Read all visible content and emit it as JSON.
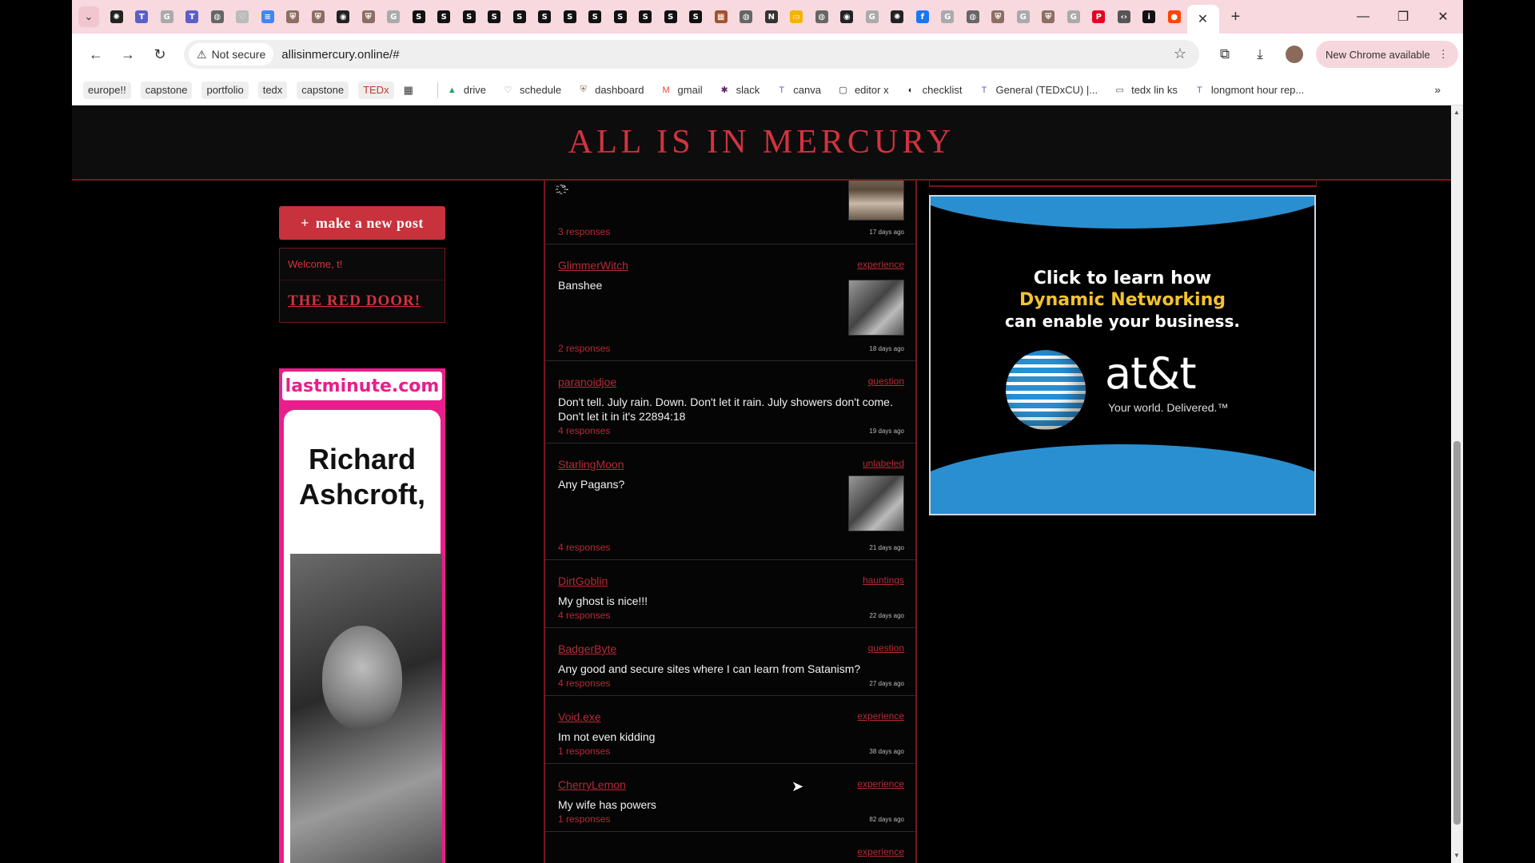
{
  "browser": {
    "tab_icons": [
      {
        "name": "openai-icon",
        "color": "#222"
      },
      {
        "name": "teams-icon",
        "color": "#5b5fc7"
      },
      {
        "name": "google-icon",
        "color": "#aaa"
      },
      {
        "name": "teams-icon",
        "color": "#5b5fc7"
      },
      {
        "name": "globe-icon",
        "color": "#666"
      },
      {
        "name": "heart-icon",
        "color": "#bbb"
      },
      {
        "name": "docs-icon",
        "color": "#4285f4"
      },
      {
        "name": "canvas-icon",
        "color": "#8d6e63"
      },
      {
        "name": "canvas-icon",
        "color": "#8d6e63"
      },
      {
        "name": "github-icon",
        "color": "#222"
      },
      {
        "name": "canvas-icon",
        "color": "#8d6e63"
      },
      {
        "name": "google-icon",
        "color": "#aaa"
      },
      {
        "name": "s-icon",
        "color": "#111"
      },
      {
        "name": "s-icon",
        "color": "#111"
      },
      {
        "name": "s-icon",
        "color": "#111"
      },
      {
        "name": "s-icon",
        "color": "#111"
      },
      {
        "name": "s-icon",
        "color": "#111"
      },
      {
        "name": "s-icon",
        "color": "#111"
      },
      {
        "name": "s-icon",
        "color": "#111"
      },
      {
        "name": "s-icon",
        "color": "#111"
      },
      {
        "name": "s-icon",
        "color": "#111"
      },
      {
        "name": "s-icon",
        "color": "#111"
      },
      {
        "name": "s-icon",
        "color": "#111"
      },
      {
        "name": "s-icon",
        "color": "#111"
      },
      {
        "name": "film-icon",
        "color": "#a0522d"
      },
      {
        "name": "globe-icon",
        "color": "#666"
      },
      {
        "name": "notion-icon",
        "color": "#333"
      },
      {
        "name": "slides-icon",
        "color": "#f4b400"
      },
      {
        "name": "globe-icon",
        "color": "#666"
      },
      {
        "name": "github-icon",
        "color": "#222"
      },
      {
        "name": "google-icon",
        "color": "#aaa"
      },
      {
        "name": "openai-icon",
        "color": "#222"
      },
      {
        "name": "facebook-icon",
        "color": "#1877f2"
      },
      {
        "name": "google-icon",
        "color": "#aaa"
      },
      {
        "name": "globe-icon",
        "color": "#666"
      },
      {
        "name": "canvas-icon",
        "color": "#8d6e63"
      },
      {
        "name": "google-icon",
        "color": "#aaa"
      },
      {
        "name": "canvas-icon",
        "color": "#8d6e63"
      },
      {
        "name": "google-icon",
        "color": "#aaa"
      },
      {
        "name": "pinterest-icon",
        "color": "#e60023"
      },
      {
        "name": "code-icon",
        "color": "#555"
      },
      {
        "name": "info-icon",
        "color": "#111"
      },
      {
        "name": "reddit-icon",
        "color": "#ff4500"
      }
    ],
    "active_tab_close": "✕",
    "new_tab": "+",
    "url": "allisinmercury.online/#",
    "security_label": "Not secure",
    "update_label": "New Chrome available"
  },
  "bookmarks": {
    "chips": [
      "europe!!",
      "capstone",
      "portfolio",
      "tedx",
      "capstone",
      "TEDx"
    ],
    "items": [
      {
        "label": "drive",
        "icon": "drive-icon",
        "color": "#1fa463"
      },
      {
        "label": "schedule",
        "icon": "heart-icon",
        "color": "#888"
      },
      {
        "label": "dashboard",
        "icon": "canvas-icon",
        "color": "#8d6e63"
      },
      {
        "label": "gmail",
        "icon": "gmail-icon",
        "color": "#ea4335"
      },
      {
        "label": "slack",
        "icon": "slack-icon",
        "color": "#611f69"
      },
      {
        "label": "canva",
        "icon": "teams-icon",
        "color": "#5b5fc7"
      },
      {
        "label": "editor x",
        "icon": "editor-icon",
        "color": "#333"
      },
      {
        "label": "checklist",
        "icon": "globe-icon",
        "color": "#222"
      },
      {
        "label": "General (TEDxCU) |...",
        "icon": "teams-icon",
        "color": "#5b5fc7"
      },
      {
        "label": "tedx lin ks",
        "icon": "folder-icon",
        "color": "#555"
      },
      {
        "label": "longmont hour rep...",
        "icon": "teams-icon",
        "color": "#5b5fc7"
      }
    ]
  },
  "site": {
    "title": "ALL IS IN MERCURY",
    "new_post_label": "make a new post",
    "welcome": "Welcome, t!",
    "red_door": "THE RED DOOR!",
    "top_fragment": ".҈°·"
  },
  "posts": [
    {
      "user": "",
      "tag": "",
      "text": "",
      "responses": "3 responses",
      "date": "17 days ago",
      "thumb": "room"
    },
    {
      "user": "GlimmerWitch",
      "tag": "experience",
      "text": "Banshee",
      "responses": "2 responses",
      "date": "18 days ago",
      "thumb": "bw"
    },
    {
      "user": "paranoidjoe",
      "tag": "question",
      "text": "Don't tell. July rain. Down. Don't let it rain. July showers don't come. Don't let it in it's 22894:18",
      "responses": "4 responses",
      "date": "19 days ago",
      "thumb": ""
    },
    {
      "user": "StarlingMoon",
      "tag": "unlabeled",
      "text": "Any Pagans?",
      "responses": "4 responses",
      "date": "21 days ago",
      "thumb": "bw"
    },
    {
      "user": "DirtGoblin",
      "tag": "hauntings",
      "text": "My ghost is nice!!!",
      "responses": "4 responses",
      "date": "22 days ago",
      "thumb": ""
    },
    {
      "user": "BadgerByte",
      "tag": "question",
      "text": "Any good and secure sites where I can learn from Satanism?",
      "responses": "4 responses",
      "date": "27 days ago",
      "thumb": ""
    },
    {
      "user": "Void.exe",
      "tag": "experience",
      "text": "Im not even kidding",
      "responses": "1 responses",
      "date": "38 days ago",
      "thumb": ""
    },
    {
      "user": "CherryLemon",
      "tag": "experience",
      "text": "My wife has powers",
      "responses": "1 responses",
      "date": "82 days ago",
      "thumb": ""
    },
    {
      "user": "",
      "tag": "experience",
      "text": "",
      "responses": "",
      "date": "",
      "thumb": ""
    }
  ],
  "ads": {
    "lastminute": {
      "logo": "lastminute.com",
      "headline_1": "Richard",
      "headline_2": "Ashcroft,"
    },
    "att": {
      "line1": "Click to learn how",
      "line2": "Dynamic Networking",
      "line3": "can enable your business.",
      "brand": "at&t",
      "tagline": "Your world. Delivered.™",
      "accent": "#2a8fd0",
      "highlight": "#f2c230"
    }
  },
  "colors": {
    "site_red": "#d2333f",
    "border_red": "#7a1520",
    "tabstrip": "#f7d9df"
  }
}
